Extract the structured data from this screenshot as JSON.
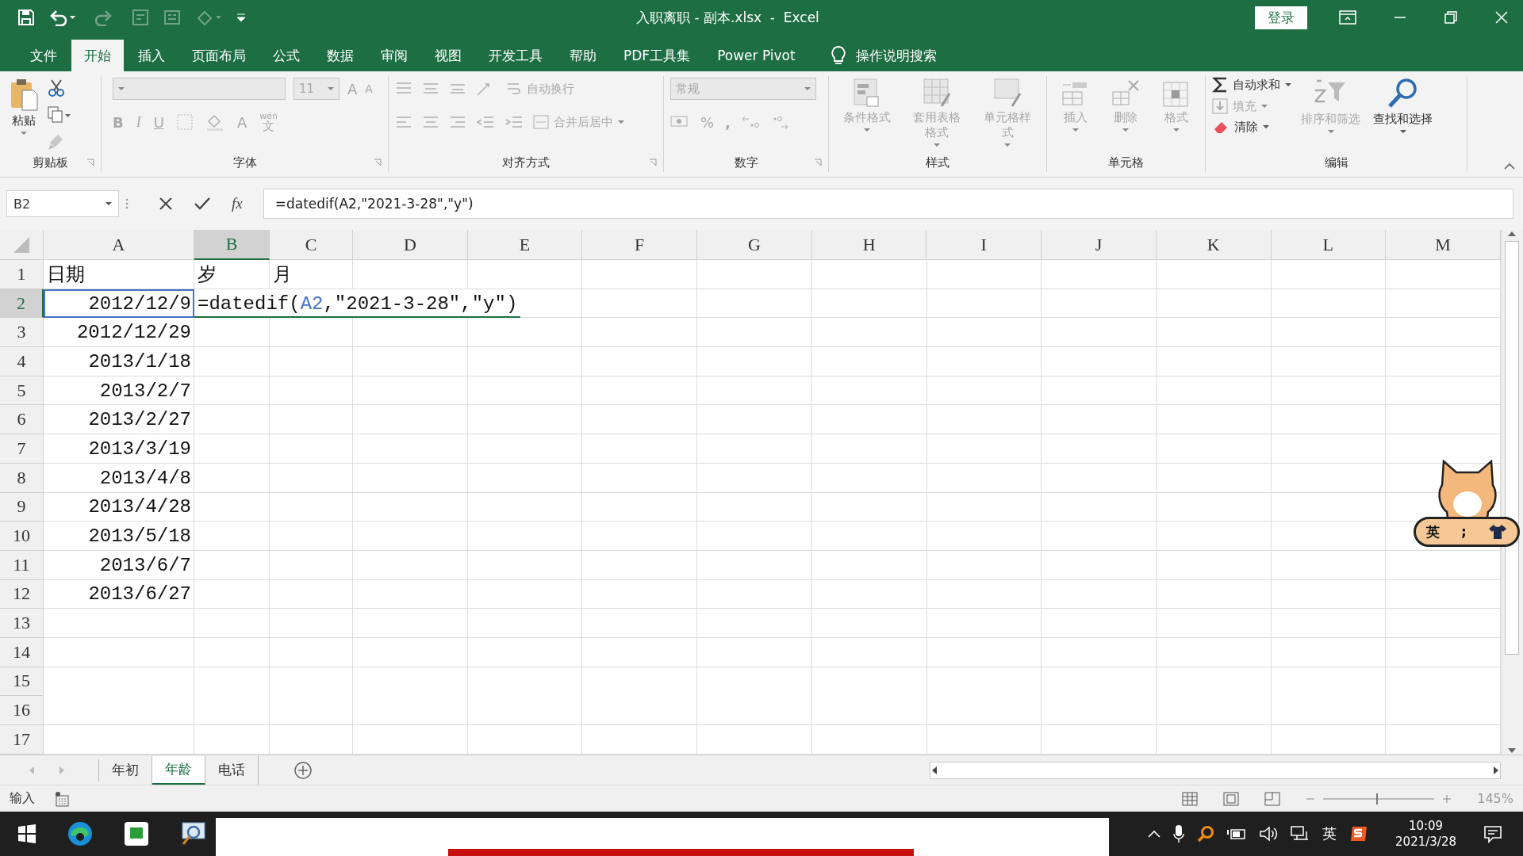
{
  "window": {
    "title": "入职离职 - 副本.xlsx  -  Excel",
    "sign_in": "登录"
  },
  "ribbon_tabs": [
    {
      "label": "文件",
      "selected": false
    },
    {
      "label": "开始",
      "selected": true
    },
    {
      "label": "插入",
      "selected": false
    },
    {
      "label": "页面布局",
      "selected": false
    },
    {
      "label": "公式",
      "selected": false
    },
    {
      "label": "数据",
      "selected": false
    },
    {
      "label": "审阅",
      "selected": false
    },
    {
      "label": "视图",
      "selected": false
    },
    {
      "label": "开发工具",
      "selected": false
    },
    {
      "label": "帮助",
      "selected": false
    },
    {
      "label": "PDF工具集",
      "selected": false
    },
    {
      "label": "Power Pivot",
      "selected": false
    }
  ],
  "tell_me": "操作说明搜索",
  "ribbon": {
    "groups": [
      {
        "kind": "clipboard",
        "label": "剪贴板",
        "paste": "粘贴",
        "disabled": false
      },
      {
        "kind": "font",
        "label": "字体",
        "font_size": "11",
        "grow": "A",
        "shrink": "A",
        "bold": "B",
        "italic": "I",
        "underline": "U",
        "font_color": "A",
        "phonetic_top": "wén",
        "phonetic_bottom": "文",
        "disabled": true
      },
      {
        "kind": "alignment",
        "label": "对齐方式",
        "wrap": "自动换行",
        "merge": "合并后居中",
        "disabled": true
      },
      {
        "kind": "number",
        "label": "数字",
        "format": "常规",
        "percent": "%",
        "comma": ",",
        "disabled": true
      },
      {
        "kind": "styles",
        "label": "样式",
        "buttons": [
          {
            "label": "条件格式",
            "disabled": true
          },
          {
            "label": "套用表格格式",
            "disabled": true
          },
          {
            "label": "单元格样式",
            "disabled": true
          }
        ]
      },
      {
        "kind": "cells",
        "label": "单元格",
        "buttons": [
          {
            "label": "插入",
            "disabled": true
          },
          {
            "label": "删除",
            "disabled": true
          },
          {
            "label": "格式",
            "disabled": true
          }
        ]
      },
      {
        "kind": "editing",
        "label": "编辑",
        "autosum": {
          "label": "自动求和",
          "disabled": false
        },
        "fill": {
          "label": "填充",
          "disabled": true
        },
        "clear": {
          "label": "清除",
          "disabled": false
        },
        "sort": {
          "label": "排序和筛选",
          "disabled": true
        },
        "find": {
          "label": "查找和选择",
          "disabled": false
        }
      }
    ]
  },
  "formula_bar": {
    "name_box": "B2",
    "function_button": "fx",
    "formula": "=datedif(A2,\"2021-3-28\",\"y\")"
  },
  "sheet": {
    "columns": [
      {
        "label": "A",
        "selected": false
      },
      {
        "label": "B",
        "selected": true
      },
      {
        "label": "C",
        "selected": false
      },
      {
        "label": "D",
        "selected": false
      },
      {
        "label": "E",
        "selected": false
      },
      {
        "label": "F",
        "selected": false
      },
      {
        "label": "G",
        "selected": false
      },
      {
        "label": "H",
        "selected": false
      },
      {
        "label": "I",
        "selected": false
      },
      {
        "label": "J",
        "selected": false
      },
      {
        "label": "K",
        "selected": false
      },
      {
        "label": "L",
        "selected": false
      },
      {
        "label": "M",
        "selected": false
      }
    ],
    "rows": [
      {
        "number": "1",
        "selected": false,
        "cells": [
          {
            "text": "日期",
            "kind": "text"
          },
          {
            "text": "岁",
            "kind": "text"
          },
          {
            "text": "月",
            "kind": "text"
          }
        ]
      },
      {
        "number": "2",
        "selected": true,
        "cells": [
          {
            "text": "2012/12/9",
            "kind": "date"
          }
        ]
      },
      {
        "number": "3",
        "selected": false,
        "cells": [
          {
            "text": "2012/12/29",
            "kind": "date"
          }
        ]
      },
      {
        "number": "4",
        "selected": false,
        "cells": [
          {
            "text": "2013/1/18",
            "kind": "date"
          }
        ]
      },
      {
        "number": "5",
        "selected": false,
        "cells": [
          {
            "text": "2013/2/7",
            "kind": "date"
          }
        ]
      },
      {
        "number": "6",
        "selected": false,
        "cells": [
          {
            "text": "2013/2/27",
            "kind": "date"
          }
        ]
      },
      {
        "number": "7",
        "selected": false,
        "cells": [
          {
            "text": "2013/3/19",
            "kind": "date"
          }
        ]
      },
      {
        "number": "8",
        "selected": false,
        "cells": [
          {
            "text": "2013/4/8",
            "kind": "date"
          }
        ]
      },
      {
        "number": "9",
        "selected": false,
        "cells": [
          {
            "text": "2013/4/28",
            "kind": "date"
          }
        ]
      },
      {
        "number": "10",
        "selected": false,
        "cells": [
          {
            "text": "2013/5/18",
            "kind": "date"
          }
        ]
      },
      {
        "number": "11",
        "selected": false,
        "cells": [
          {
            "text": "2013/6/7",
            "kind": "date"
          }
        ]
      },
      {
        "number": "12",
        "selected": false,
        "cells": [
          {
            "text": "2013/6/27",
            "kind": "date"
          }
        ]
      },
      {
        "number": "13",
        "selected": false
      },
      {
        "number": "14",
        "selected": false
      },
      {
        "number": "15",
        "selected": false
      },
      {
        "number": "16",
        "selected": false
      },
      {
        "number": "17",
        "selected": false
      }
    ],
    "editor": {
      "before": "=datedif(",
      "reference": "A2",
      "after": ",\"2021-3-28\",\"y\")"
    }
  },
  "sheet_tabs": [
    {
      "label": "年初",
      "selected": false
    },
    {
      "label": "年龄",
      "selected": true
    },
    {
      "label": "电话",
      "selected": false
    }
  ],
  "status_bar": {
    "mode": "输入",
    "zoom_slider": {
      "level": 0.48
    },
    "zoom": "145%"
  },
  "ime_widget": {
    "mode": "英",
    "punct": ";"
  },
  "taskbar": {
    "ime": "英",
    "time": "10:09",
    "date": "2021/3/28"
  }
}
